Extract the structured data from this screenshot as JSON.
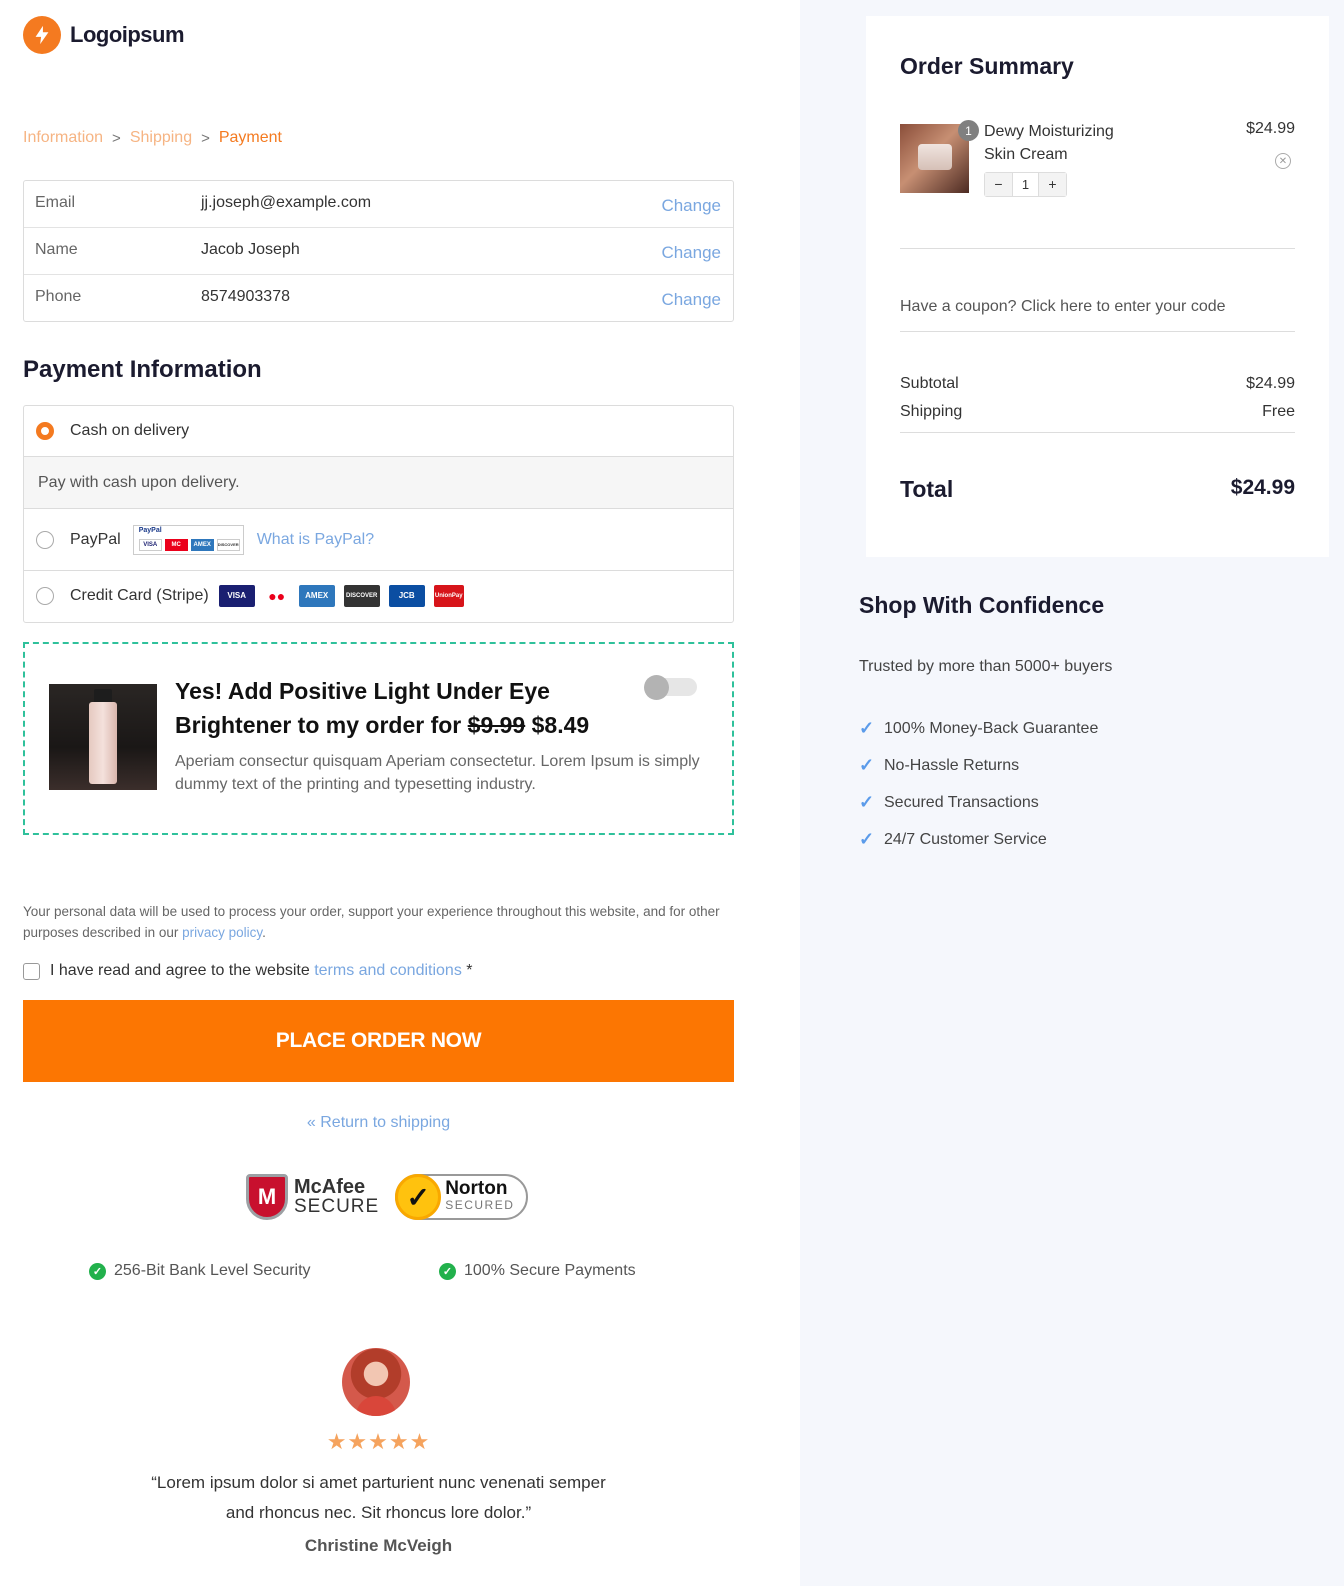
{
  "logo": {
    "text": "Logoipsum"
  },
  "breadcrumb": {
    "information": "Information",
    "shipping": "Shipping",
    "payment": "Payment",
    "separator": ">"
  },
  "info": {
    "rows": [
      {
        "label": "Email",
        "value": "jj.joseph@example.com",
        "action": "Change"
      },
      {
        "label": "Name",
        "value": "Jacob Joseph",
        "action": "Change"
      },
      {
        "label": "Phone",
        "value": "8574903378",
        "action": "Change"
      }
    ]
  },
  "payment": {
    "title": "Payment Information",
    "cod_label": "Cash on delivery",
    "cod_desc": "Pay with cash upon delivery.",
    "paypal_label": "PayPal",
    "paypal_badge": "PayPal",
    "paypal_cards": [
      "VISA",
      "MC",
      "AMEX",
      "DISCOVER"
    ],
    "what_paypal": "What is PayPal?",
    "card_label": "Credit Card (Stripe)",
    "card_brands": [
      "VISA",
      "●●",
      "AMEX",
      "DISCOVER",
      "JCB",
      "UnionPay"
    ]
  },
  "upsell": {
    "title_main": "Yes! Add Positive Light Under Eye Brightener to my order for",
    "old_price": "$9.99",
    "new_price": "$8.49",
    "description": "Aperiam consectur quisquam Aperiam consectetur. Lorem Ipsum is simply dummy text of the printing and typesetting industry.",
    "enabled": false
  },
  "privacy": {
    "text": "Your personal data will be used to process your order, support your experience throughout this website, and for other purposes described in our",
    "link": "privacy policy",
    "end": "."
  },
  "agree": {
    "text": "I have read and agree to the website",
    "link": "terms and conditions",
    "required": "*"
  },
  "place_order": "PLACE ORDER NOW",
  "return_link": "« Return to shipping",
  "badges": {
    "mcafee_name": "McAfee",
    "mcafee_secure": "SECURE",
    "mcafee_mark": "M",
    "norton_name": "Norton",
    "norton_secured": "SECURED"
  },
  "security": {
    "feature1": "256-Bit Bank Level Security",
    "feature2": "100% Secure Payments"
  },
  "testimonial": {
    "stars": "★★★★★",
    "rating": 5,
    "quote": "“Lorem ipsum dolor si amet parturient nunc venenati semper and rhoncus nec. Sit rhoncus lore dolor.”",
    "author": "Christine McVeigh"
  },
  "summary": {
    "title": "Order Summary",
    "product_name": "Dewy Moisturizing Skin Cream",
    "product_price": "$24.99",
    "qty_badge": "1",
    "qty_value": "1",
    "minus": "−",
    "plus": "+",
    "coupon": "Have a coupon? Click here to enter your code",
    "subtotal_label": "Subtotal",
    "subtotal_value": "$24.99",
    "shipping_label": "Shipping",
    "shipping_value": "Free",
    "total_label": "Total",
    "total_value": "$24.99"
  },
  "confidence": {
    "title": "Shop With Confidence",
    "subtitle": "Trusted by more than 5000+ buyers",
    "items": [
      "100% Money-Back Guarantee",
      "No-Hassle Returns",
      "Secured Transactions",
      "24/7 Customer Service"
    ]
  },
  "colors": {
    "accent": "#fc7602",
    "link": "#7aa7e0",
    "upsell_border": "#2fc19b",
    "right_bg": "#f5f7fc"
  }
}
